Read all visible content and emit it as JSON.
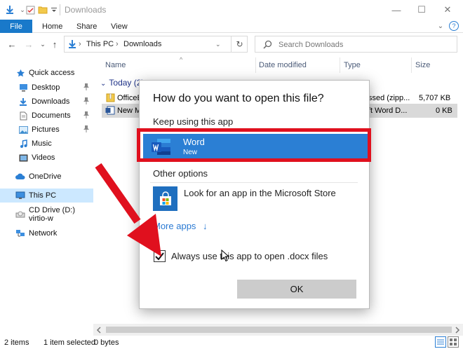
{
  "window": {
    "title": "Downloads",
    "controls": {
      "minimize": "—",
      "maximize": "☐",
      "close": "✕"
    }
  },
  "ribbon": {
    "tabs": [
      "File",
      "Home",
      "Share",
      "View"
    ],
    "collapse_glyph": "⌄",
    "help_glyph": "?"
  },
  "address_bar": {
    "breadcrumb": [
      "This PC",
      "Downloads"
    ],
    "crumb_separator": "›",
    "search_placeholder": "Search Downloads"
  },
  "nav_glyphs": {
    "back": "←",
    "forward": "→",
    "recent": "⌄",
    "up": "↑",
    "dropdown": "⌄",
    "refresh": "↻"
  },
  "navigation_pane": {
    "items": [
      {
        "label": "Quick access",
        "icon": "star-icon"
      },
      {
        "label": "Desktop",
        "icon": "desktop-icon",
        "pinned": true
      },
      {
        "label": "Downloads",
        "icon": "download-icon",
        "pinned": true
      },
      {
        "label": "Documents",
        "icon": "documents-icon",
        "pinned": true
      },
      {
        "label": "Pictures",
        "icon": "pictures-icon",
        "pinned": true
      },
      {
        "label": "Music",
        "icon": "music-icon"
      },
      {
        "label": "Videos",
        "icon": "videos-icon"
      },
      {
        "label": "OneDrive",
        "icon": "cloud-icon"
      },
      {
        "label": "This PC",
        "icon": "computer-icon",
        "selected": true
      },
      {
        "label": "CD Drive (D:) virtio-w",
        "icon": "cd-drive-icon"
      },
      {
        "label": "Network",
        "icon": "network-icon"
      }
    ],
    "pin_glyph": "📌"
  },
  "file_list": {
    "columns": [
      "Name",
      "Date modified",
      "Type",
      "Size"
    ],
    "sort_glyph": "^",
    "group_label": "Today (2)",
    "group_glyph": "⌄",
    "rows": [
      {
        "name": "OfficeE",
        "type": "ssed (zipp...",
        "size": "5,707 KB",
        "icon": "zip-folder-icon"
      },
      {
        "name": "New M",
        "type": "ft Word D...",
        "size": "0 KB",
        "icon": "word-document-icon",
        "selected": true
      }
    ]
  },
  "status_bar": {
    "item_count": "2 items",
    "selection": "1 item selected",
    "size": "0 bytes"
  },
  "dialog": {
    "title": "How do you want to open this file?",
    "keep_label": "Keep using this app",
    "selected_app": {
      "name": "Word",
      "sub": "New"
    },
    "other_label": "Other options",
    "store_option": "Look for an app in the Microsoft Store",
    "more_apps": "More apps",
    "more_glyph": "↓",
    "always_use": "Always use this app to open .docx files",
    "always_checked": true,
    "ok": "OK"
  },
  "colors": {
    "accent": "#1979ca",
    "selection": "#2b7fd4",
    "highlight_box": "#e0101e",
    "arrow": "#e0101e"
  }
}
